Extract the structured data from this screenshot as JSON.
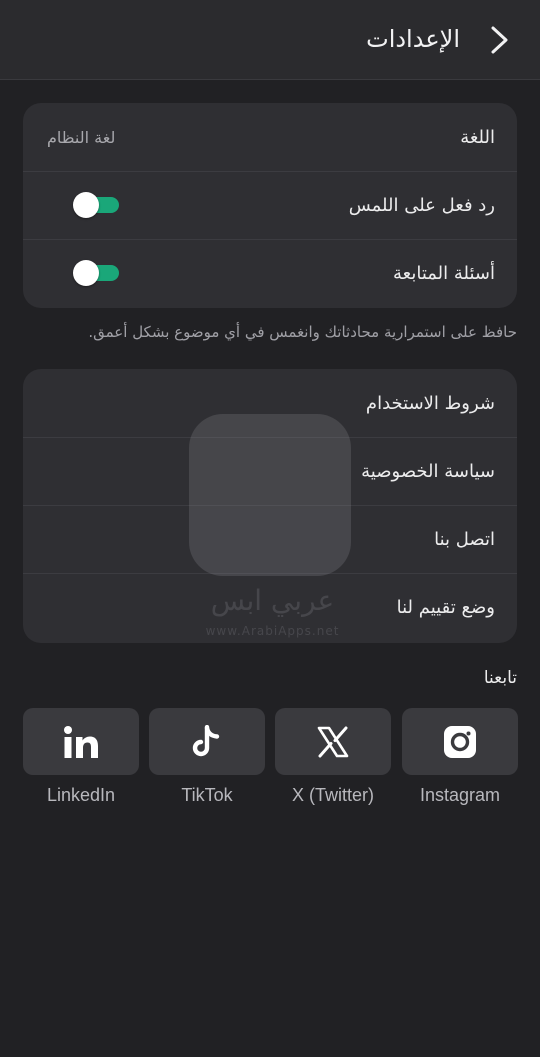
{
  "header": {
    "title": "الإعدادات",
    "back_icon": "chevron-right-icon"
  },
  "preferences": {
    "language": {
      "label": "اللغة",
      "value": "لغة النظام"
    },
    "haptics": {
      "label": "رد فعل على اللمس",
      "enabled": true
    },
    "follow_up": {
      "label": "أسئلة المتابعة",
      "enabled": true
    }
  },
  "hint": "حافظ على استمرارية محادثاتك وانغمس في أي موضوع بشكل أعمق.",
  "links": {
    "terms": "شروط الاستخدام",
    "privacy": "سياسة الخصوصية",
    "contact": "اتصل بنا",
    "rate": "وضع تقييم لنا"
  },
  "follow": {
    "title": "تابعنا",
    "items": [
      {
        "name": "Instagram",
        "icon": "instagram-icon"
      },
      {
        "name": "X (Twitter)",
        "icon": "x-icon"
      },
      {
        "name": "TikTok",
        "icon": "tiktok-icon"
      },
      {
        "name": "LinkedIn",
        "icon": "linkedin-icon"
      }
    ]
  },
  "watermark": {
    "text": "عربي ابس",
    "url": "www.ArabiApps.net"
  },
  "colors": {
    "background": "#212124",
    "card": "#2f2f33",
    "toggle_on": "#1aa779",
    "social_box": "#3a3a3e"
  }
}
